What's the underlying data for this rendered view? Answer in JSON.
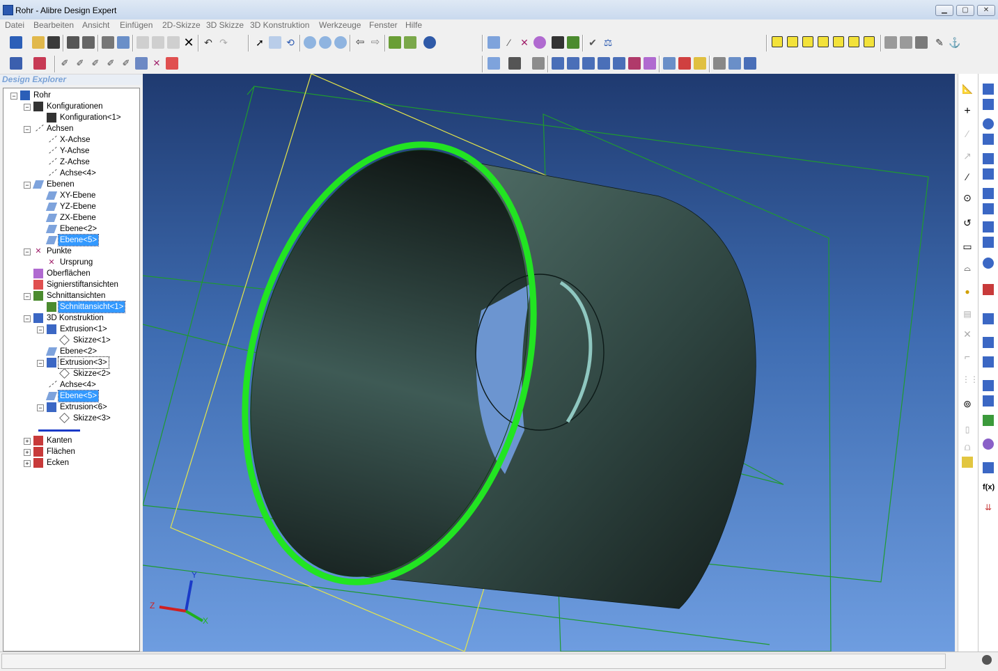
{
  "window": {
    "title": "Rohr - Alibre Design Expert"
  },
  "menu": [
    "Datei",
    "Bearbeiten",
    "Ansicht",
    "Einfügen",
    "2D-Skizze",
    "3D Skizze",
    "3D Konstruktion",
    "Werkzeuge",
    "Fenster",
    "Hilfe"
  ],
  "explorer": {
    "title": "Design Explorer",
    "nodes": [
      {
        "label": "Rohr",
        "icon": "part-icon",
        "level": 0,
        "exp": "-"
      },
      {
        "label": "Konfigurationen",
        "icon": "configurations-icon",
        "level": 1,
        "exp": "-"
      },
      {
        "label": "Konfiguration<1>",
        "icon": "configuration-icon",
        "level": 2,
        "exp": ""
      },
      {
        "label": "Achsen",
        "icon": "axis-icon",
        "level": 1,
        "exp": "-"
      },
      {
        "label": "X-Achse",
        "icon": "axis-icon",
        "level": 2,
        "exp": ""
      },
      {
        "label": "Y-Achse",
        "icon": "axis-icon",
        "level": 2,
        "exp": ""
      },
      {
        "label": "Z-Achse",
        "icon": "axis-icon",
        "level": 2,
        "exp": ""
      },
      {
        "label": "Achse<4>",
        "icon": "axis-icon",
        "level": 2,
        "exp": ""
      },
      {
        "label": "Ebenen",
        "icon": "plane-icon",
        "level": 1,
        "exp": "-"
      },
      {
        "label": "XY-Ebene",
        "icon": "plane-icon",
        "level": 2,
        "exp": ""
      },
      {
        "label": "YZ-Ebene",
        "icon": "plane-icon",
        "level": 2,
        "exp": ""
      },
      {
        "label": "ZX-Ebene",
        "icon": "plane-icon",
        "level": 2,
        "exp": ""
      },
      {
        "label": "Ebene<2>",
        "icon": "plane-icon",
        "level": 2,
        "exp": ""
      },
      {
        "label": "Ebene<5>",
        "icon": "plane-icon",
        "level": 2,
        "exp": "",
        "selected": true
      },
      {
        "label": "Punkte",
        "icon": "point-icon",
        "level": 1,
        "exp": "-"
      },
      {
        "label": "Ursprung",
        "icon": "point-icon",
        "level": 2,
        "exp": ""
      },
      {
        "label": "Oberflächen",
        "icon": "surface-icon",
        "level": 1,
        "exp": ""
      },
      {
        "label": "Signierstiftansichten",
        "icon": "redline-icon",
        "level": 1,
        "exp": ""
      },
      {
        "label": "Schnittansichten",
        "icon": "section-icon",
        "level": 1,
        "exp": "-"
      },
      {
        "label": "Schnittansicht<1>",
        "icon": "section-icon",
        "level": 2,
        "exp": "",
        "selected": true
      },
      {
        "label": "3D Konstruktion",
        "icon": "feature-icon",
        "level": 1,
        "exp": "-"
      },
      {
        "label": "Extrusion<1>",
        "icon": "extrude-icon",
        "level": 2,
        "exp": "-"
      },
      {
        "label": "Skizze<1>",
        "icon": "sketch-icon",
        "level": 3,
        "exp": ""
      },
      {
        "label": "Ebene<2>",
        "icon": "plane-icon",
        "level": 2,
        "exp": ""
      },
      {
        "label": "Extrusion<3>",
        "icon": "extrude-icon",
        "level": 2,
        "exp": "-",
        "focused": true
      },
      {
        "label": "Skizze<2>",
        "icon": "sketch-icon",
        "level": 3,
        "exp": ""
      },
      {
        "label": "Achse<4>",
        "icon": "axis-icon",
        "level": 2,
        "exp": ""
      },
      {
        "label": "Ebene<5>",
        "icon": "plane-icon",
        "level": 2,
        "exp": "",
        "selected": true
      },
      {
        "label": "Extrusion<6>",
        "icon": "extrude-icon",
        "level": 2,
        "exp": "-"
      },
      {
        "label": "Skizze<3>",
        "icon": "sketch-icon",
        "level": 3,
        "exp": ""
      },
      {
        "label": "",
        "icon": "rollback-bar-icon",
        "level": 2,
        "exp": ""
      },
      {
        "label": "Kanten",
        "icon": "edges-icon",
        "level": 1,
        "exp": "+"
      },
      {
        "label": "Flächen",
        "icon": "faces-icon",
        "level": 1,
        "exp": "+"
      },
      {
        "label": "Ecken",
        "icon": "vertices-icon",
        "level": 1,
        "exp": "+"
      }
    ]
  },
  "triad": {
    "z": "Z",
    "y": "Y",
    "x": "X"
  },
  "colors": {
    "part_body": "#3f5a54",
    "highlight_edge": "#22e422",
    "plane_outline": "#1f9a2f",
    "active_plane": "#e6e64a",
    "accent": "#3399ff"
  }
}
